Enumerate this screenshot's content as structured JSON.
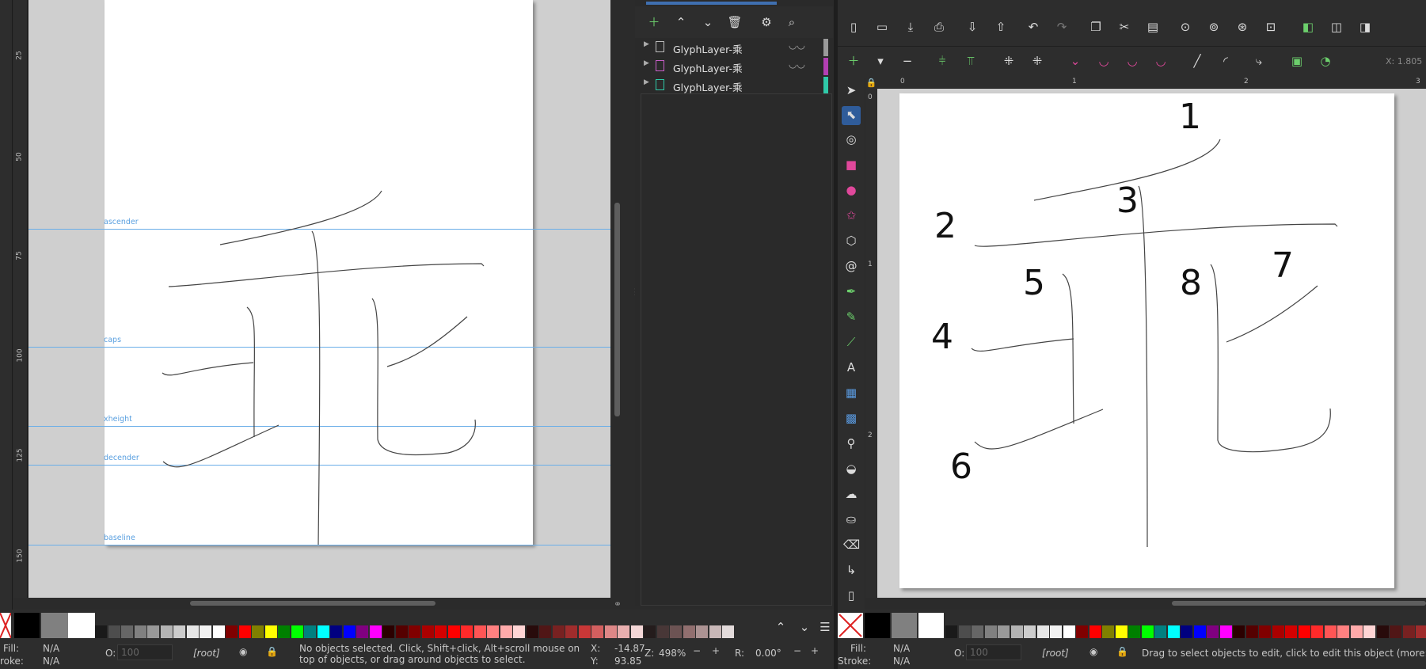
{
  "left_window": {
    "ruler_ticks": [
      "25",
      "50",
      "75",
      "100",
      "125",
      "150"
    ],
    "guides": [
      {
        "label": "ascender"
      },
      {
        "label": "caps"
      },
      {
        "label": "xheight"
      },
      {
        "label": "decender"
      },
      {
        "label": "baseline"
      }
    ],
    "status": {
      "fill_label": "Fill:",
      "fill_value": "N/A",
      "stroke_label": "roke:",
      "stroke_value": "N/A",
      "opacity_label": "O:",
      "opacity_value": "100",
      "layer": "[root]",
      "message": "No objects selected. Click, Shift+click, Alt+scroll mouse on top of objects, or drag around objects to select.",
      "x_label": "X:",
      "x_value": "-14.87",
      "y_label": "Y:",
      "y_value": "93.85",
      "zoom_label": "Z:",
      "zoom_value": "498%",
      "rotation_label": "R:",
      "rotation_value": "0.00°"
    }
  },
  "layers_panel": {
    "layers": [
      {
        "name": "GlyphLayer-乘",
        "color": "#9a9a9a"
      },
      {
        "name": "GlyphLayer-乘",
        "color": "#b33fb3"
      },
      {
        "name": "GlyphLayer-乘",
        "color": "#2fc9a8"
      }
    ]
  },
  "right_window": {
    "ruler_h_ticks": [
      "0",
      "1",
      "2",
      "3"
    ],
    "ruler_v_ticks": [
      "0",
      "1",
      "2"
    ],
    "coord_fragment": "X: 1.805",
    "stroke_numbers": [
      "1",
      "2",
      "3",
      "4",
      "5",
      "6",
      "7",
      "8"
    ],
    "status": {
      "fill_label": "Fill:",
      "fill_value": "N/A",
      "stroke_label": "Stroke:",
      "stroke_value": "N/A",
      "opacity_label": "O:",
      "opacity_value": "100",
      "layer": "[root]",
      "message": "Drag to select objects to edit, click to edit this object (more: Shift)"
    }
  },
  "palette_colors": [
    "#000000",
    "#808080",
    "#ffffff",
    "#1a1a1a",
    "#4d4d4d",
    "#666666",
    "#808080",
    "#999999",
    "#b3b3b3",
    "#cccccc",
    "#e6e6e6",
    "#f2f2f2",
    "#ffffff",
    "#800000",
    "#ff0000",
    "#808000",
    "#ffff00",
    "#008000",
    "#00ff00",
    "#008080",
    "#00ffff",
    "#000080",
    "#0000ff",
    "#800080",
    "#ff00ff",
    "#2b0000",
    "#550000",
    "#800000",
    "#aa0000",
    "#d40000",
    "#ff0000",
    "#ff2a2a",
    "#ff5555",
    "#ff8080",
    "#ffaaaa",
    "#ffd5d5",
    "#280b0b",
    "#501616",
    "#782121",
    "#a02c2c",
    "#c83737",
    "#d35f5f",
    "#de8787",
    "#e9afaf",
    "#f4d7d7",
    "#241c1c",
    "#483737",
    "#6c5353",
    "#916f6f",
    "#ac9393",
    "#c8b7b7",
    "#e3dbdb"
  ]
}
